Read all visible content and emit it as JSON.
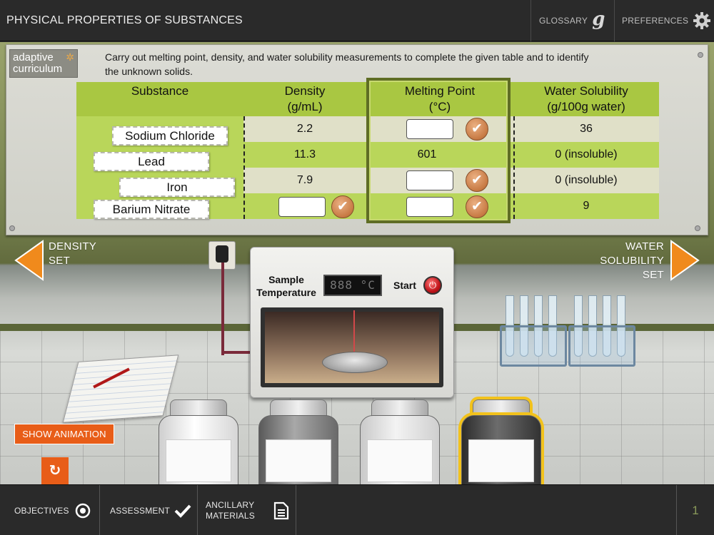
{
  "app": {
    "title": "PHYSICAL PROPERTIES OF SUBSTANCES",
    "glossary_label": "GLOSSARY",
    "glossary_glyph": "g",
    "preferences_label": "PREFERENCES"
  },
  "panel": {
    "logo_line1": "adaptive",
    "logo_line2": "curriculum",
    "instructions": "Carry out melting point, density, and water solubility measurements to complete the given table and to identify the unknown solids."
  },
  "table": {
    "headers": {
      "substance": "Substance",
      "density": "Density",
      "density_unit": "(g/mL)",
      "melting": "Melting Point",
      "melting_unit": "(°C)",
      "solubility": "Water Solubility",
      "solubility_unit": "(g/100g water)"
    },
    "rows": [
      {
        "substance": "Sodium Chloride",
        "density": "2.2",
        "melting": "",
        "solubility": "36"
      },
      {
        "substance": "Lead",
        "density": "11.3",
        "melting": "601",
        "solubility": "0 (insoluble)"
      },
      {
        "substance": "Iron",
        "density": "7.9",
        "melting": "",
        "solubility": "0 (insoluble)"
      },
      {
        "substance": "Barium Nitrate",
        "density": "",
        "melting": "",
        "solubility": "9"
      }
    ],
    "check_glyph": "✔"
  },
  "nav": {
    "prev_line1": "DENSITY",
    "prev_line2": "SET",
    "next_line1": "WATER",
    "next_line2": "SOLUBILITY",
    "next_line3": "SET"
  },
  "oven": {
    "sample_label_1": "Sample",
    "sample_label_2": "Temperature",
    "display": "888 °C",
    "start_label": "Start",
    "start_glyph": "⏻"
  },
  "controls": {
    "show_animation": "SHOW ANIMATION",
    "reset_glyph": "↻"
  },
  "bottom": {
    "objectives": "OBJECTIVES",
    "assessment": "ASSESSMENT",
    "ancillary_1": "ANCILLARY",
    "ancillary_2": "MATERIALS",
    "page": "1"
  },
  "colors": {
    "accent_orange": "#e85d18",
    "arrow_orange": "#f08a1c",
    "table_green": "#a9c742",
    "check_tan": "#c77a44",
    "selection_yellow": "#f2c21c"
  },
  "icons": {
    "preferences": "gear-icon",
    "objectives": "target-icon",
    "assessment": "checkmark-icon",
    "ancillary": "document-icon",
    "reset": "reset-icon"
  }
}
